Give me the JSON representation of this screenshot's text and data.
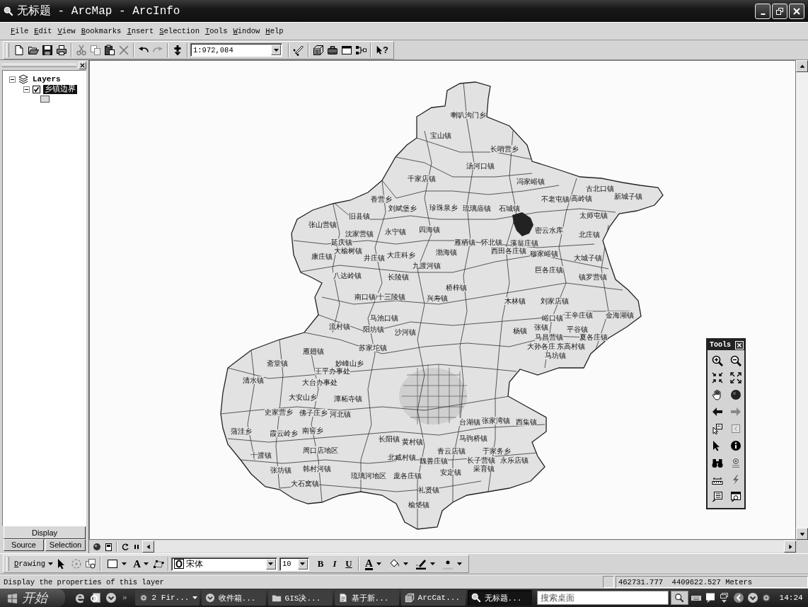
{
  "window": {
    "title": "无标题 - ArcMap - ArcInfo"
  },
  "menu": [
    "File",
    "Edit",
    "View",
    "Bookmarks",
    "Insert",
    "Selection",
    "Tools",
    "Window",
    "Help"
  ],
  "standard_toolbar": {
    "scale": "1:972,084",
    "whats_this_mark": "?"
  },
  "toc": {
    "tree": {
      "label": "Layers",
      "expanded": true,
      "selected": false,
      "children": [
        {
          "label": "乡镇边界",
          "checked": true,
          "selected": true,
          "expanded": true
        }
      ]
    },
    "tabs": [
      {
        "label": "Display",
        "selected": true
      },
      {
        "label": "Source",
        "selected": false
      },
      {
        "label": "Selection",
        "selected": false
      }
    ]
  },
  "map": {
    "place_labels": [
      "喇叭沟门乡",
      "宝山镇",
      "长哨营乡",
      "汤河口镇",
      "千家店镇",
      "冯家峪镇",
      "古北口镇",
      "香营乡",
      "不老屯镇",
      "高岭镇",
      "新城子镇",
      "刘斌堡乡",
      "珍珠泉乡",
      "琉璃庙镇",
      "石城镇",
      "旧县镇",
      "太师屯镇",
      "张山营镇",
      "沈家营镇",
      "永宁镇",
      "四海镇",
      "密云水库",
      "北庄镇",
      "延庆镇",
      "雁栖镇",
      "怀北镇",
      "溪翁庄镇",
      "康庄镇",
      "大榆树镇",
      "井庄镇",
      "大庄科乡",
      "渤海镇",
      "西田各庄镇",
      "穆家峪镇",
      "大城子镇",
      "九渡河镇",
      "八达岭镇",
      "长陵镇",
      "巨各庄镇",
      "镇罗营镇",
      "桥梓镇",
      "南口镇",
      "十三陵镇",
      "兴寿镇",
      "木林镇",
      "刘家店镇",
      "马池口镇",
      "峪口镇",
      "王辛庄镇",
      "金海湖镇",
      "流村镇",
      "阳坊镇",
      "沙河镇",
      "杨镇",
      "张镇",
      "平谷镇",
      "马昌营镇",
      "夏各庄镇",
      "雁翅镇",
      "苏家坨镇",
      "大孙各庄",
      "东高村镇",
      "马坊镇",
      "斋堂镇",
      "妙峰山乡",
      "王平办事处",
      "清水镇",
      "大台办事处",
      "大安山乡",
      "潭柘寺镇",
      "史家营乡",
      "佛子庄乡",
      "河北镇",
      "台湖镇",
      "张家湾镇",
      "西集镇",
      "蒲洼乡",
      "霞云岭乡",
      "南窖乡",
      "长阳镇",
      "黄村镇",
      "马驹桥镇",
      "十渡镇",
      "周口店地区",
      "北臧村镇",
      "青云店镇",
      "于家务乡",
      "魏善庄镇",
      "长子营镇",
      "永乐店镇",
      "张坊镇",
      "韩村河镇",
      "琉璃河地区",
      "庞各庄镇",
      "安定镇",
      "采育镇",
      "大石窝镇",
      "礼贤镇",
      "榆垡镇"
    ]
  },
  "tools_palette": {
    "title": "Tools"
  },
  "drawing_toolbar": {
    "menu": "Drawing",
    "text_tool": "A",
    "font": "宋体",
    "font_size": "10",
    "style_buttons": [
      "B",
      "I",
      "U"
    ],
    "font_color": "A"
  },
  "status_bar": {
    "message": "Display the properties of this layer",
    "coordinates": "462731.777  4409622.527 Meters"
  },
  "taskbar": {
    "start": "开始",
    "more": "»",
    "tasks": [
      {
        "label": "2 Fir...",
        "selected": false,
        "grouped": true
      },
      {
        "label": "收件箱...",
        "selected": false,
        "grouped": false
      },
      {
        "label": "GIS决...",
        "selected": false,
        "grouped": false
      },
      {
        "label": "基于新...",
        "selected": false,
        "grouped": false
      },
      {
        "label": "ArcCat...",
        "selected": false,
        "grouped": false
      },
      {
        "label": "无标题...",
        "selected": true,
        "grouped": false
      }
    ],
    "search": {
      "placeholder": "搜索桌面"
    },
    "clock": "14:24"
  }
}
